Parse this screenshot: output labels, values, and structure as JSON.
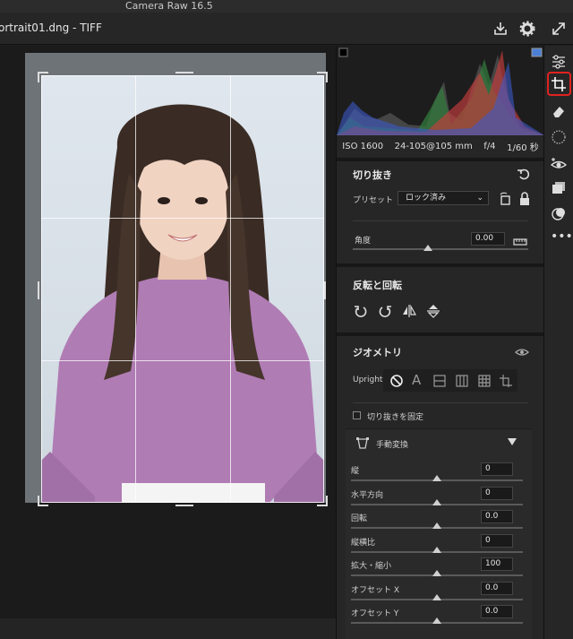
{
  "app": {
    "title": "Camera Raw 16.5"
  },
  "header": {
    "filename": "ortrait01.dng  -  TIFF"
  },
  "histogram": {
    "exif": {
      "iso": "ISO 1600",
      "lens": "24-105@105 mm",
      "aperture": "f/4",
      "shutter": "1/60 秒"
    }
  },
  "crop": {
    "title": "切り抜き",
    "preset_label": "プリセット",
    "preset_value": "ロック済み",
    "angle_label": "角度",
    "angle_value": "0.00"
  },
  "flip": {
    "title": "反転と回転"
  },
  "geometry": {
    "title": "ジオメトリ",
    "upright_label": "Upright",
    "constrain_label": "切り抜きを固定",
    "manual_label": "手動変換",
    "sliders": [
      {
        "label": "縦",
        "value": "0",
        "level": 0.5
      },
      {
        "label": "水平方向",
        "value": "0",
        "level": 0.5
      },
      {
        "label": "回転",
        "value": "0.0",
        "level": 0.5
      },
      {
        "label": "縦横比",
        "value": "0",
        "level": 0.5
      },
      {
        "label": "拡大・縮小",
        "value": "100",
        "level": 0.5
      },
      {
        "label": "オフセット X",
        "value": "0.0",
        "level": 0.5
      },
      {
        "label": "オフセット Y",
        "value": "0.0",
        "level": 0.5
      }
    ]
  },
  "colors": {
    "highlight": "#e0221f",
    "panel": "#262626"
  }
}
